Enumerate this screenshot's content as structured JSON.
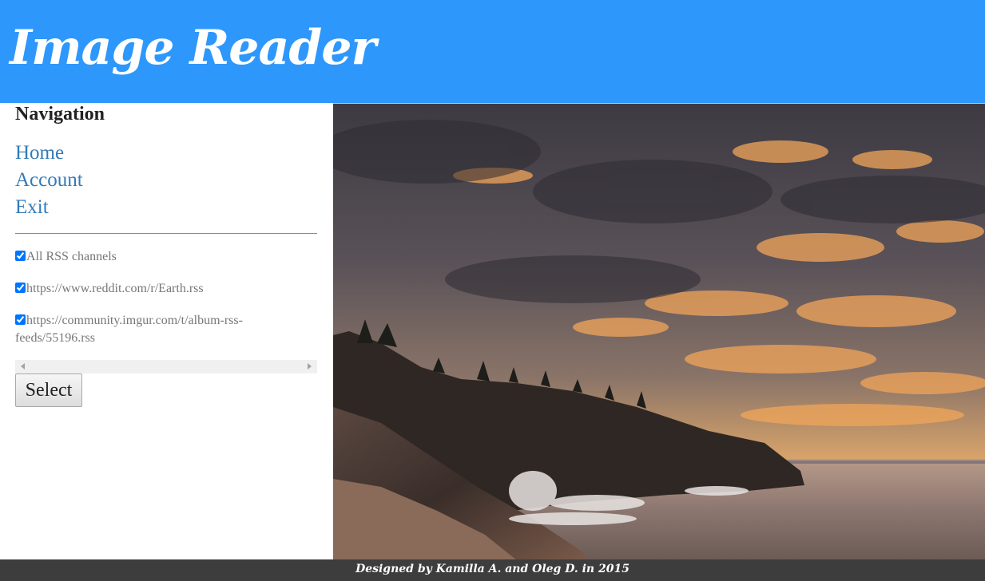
{
  "app": {
    "title": "Image Reader"
  },
  "navigation": {
    "heading": "Navigation",
    "links": [
      {
        "label": "Home"
      },
      {
        "label": "Account"
      },
      {
        "label": "Exit"
      }
    ]
  },
  "feeds": {
    "items": [
      {
        "label": "All RSS channels",
        "checked": true
      },
      {
        "label": "https://www.reddit.com/r/Earth.rss",
        "checked": true
      },
      {
        "label": "https://community.imgur.com/t/album-rss-feeds/55196.rss",
        "checked": true
      }
    ],
    "select_label": "Select"
  },
  "image": {
    "subject": "rocky coastline at sunset with waves and cloudy sky"
  },
  "footer": {
    "text": "Designed by Kamilla A. and Oleg D. in 2015"
  },
  "colors": {
    "header": "#2e97fb",
    "link": "#337ab7",
    "footer": "#3d3d3d"
  }
}
